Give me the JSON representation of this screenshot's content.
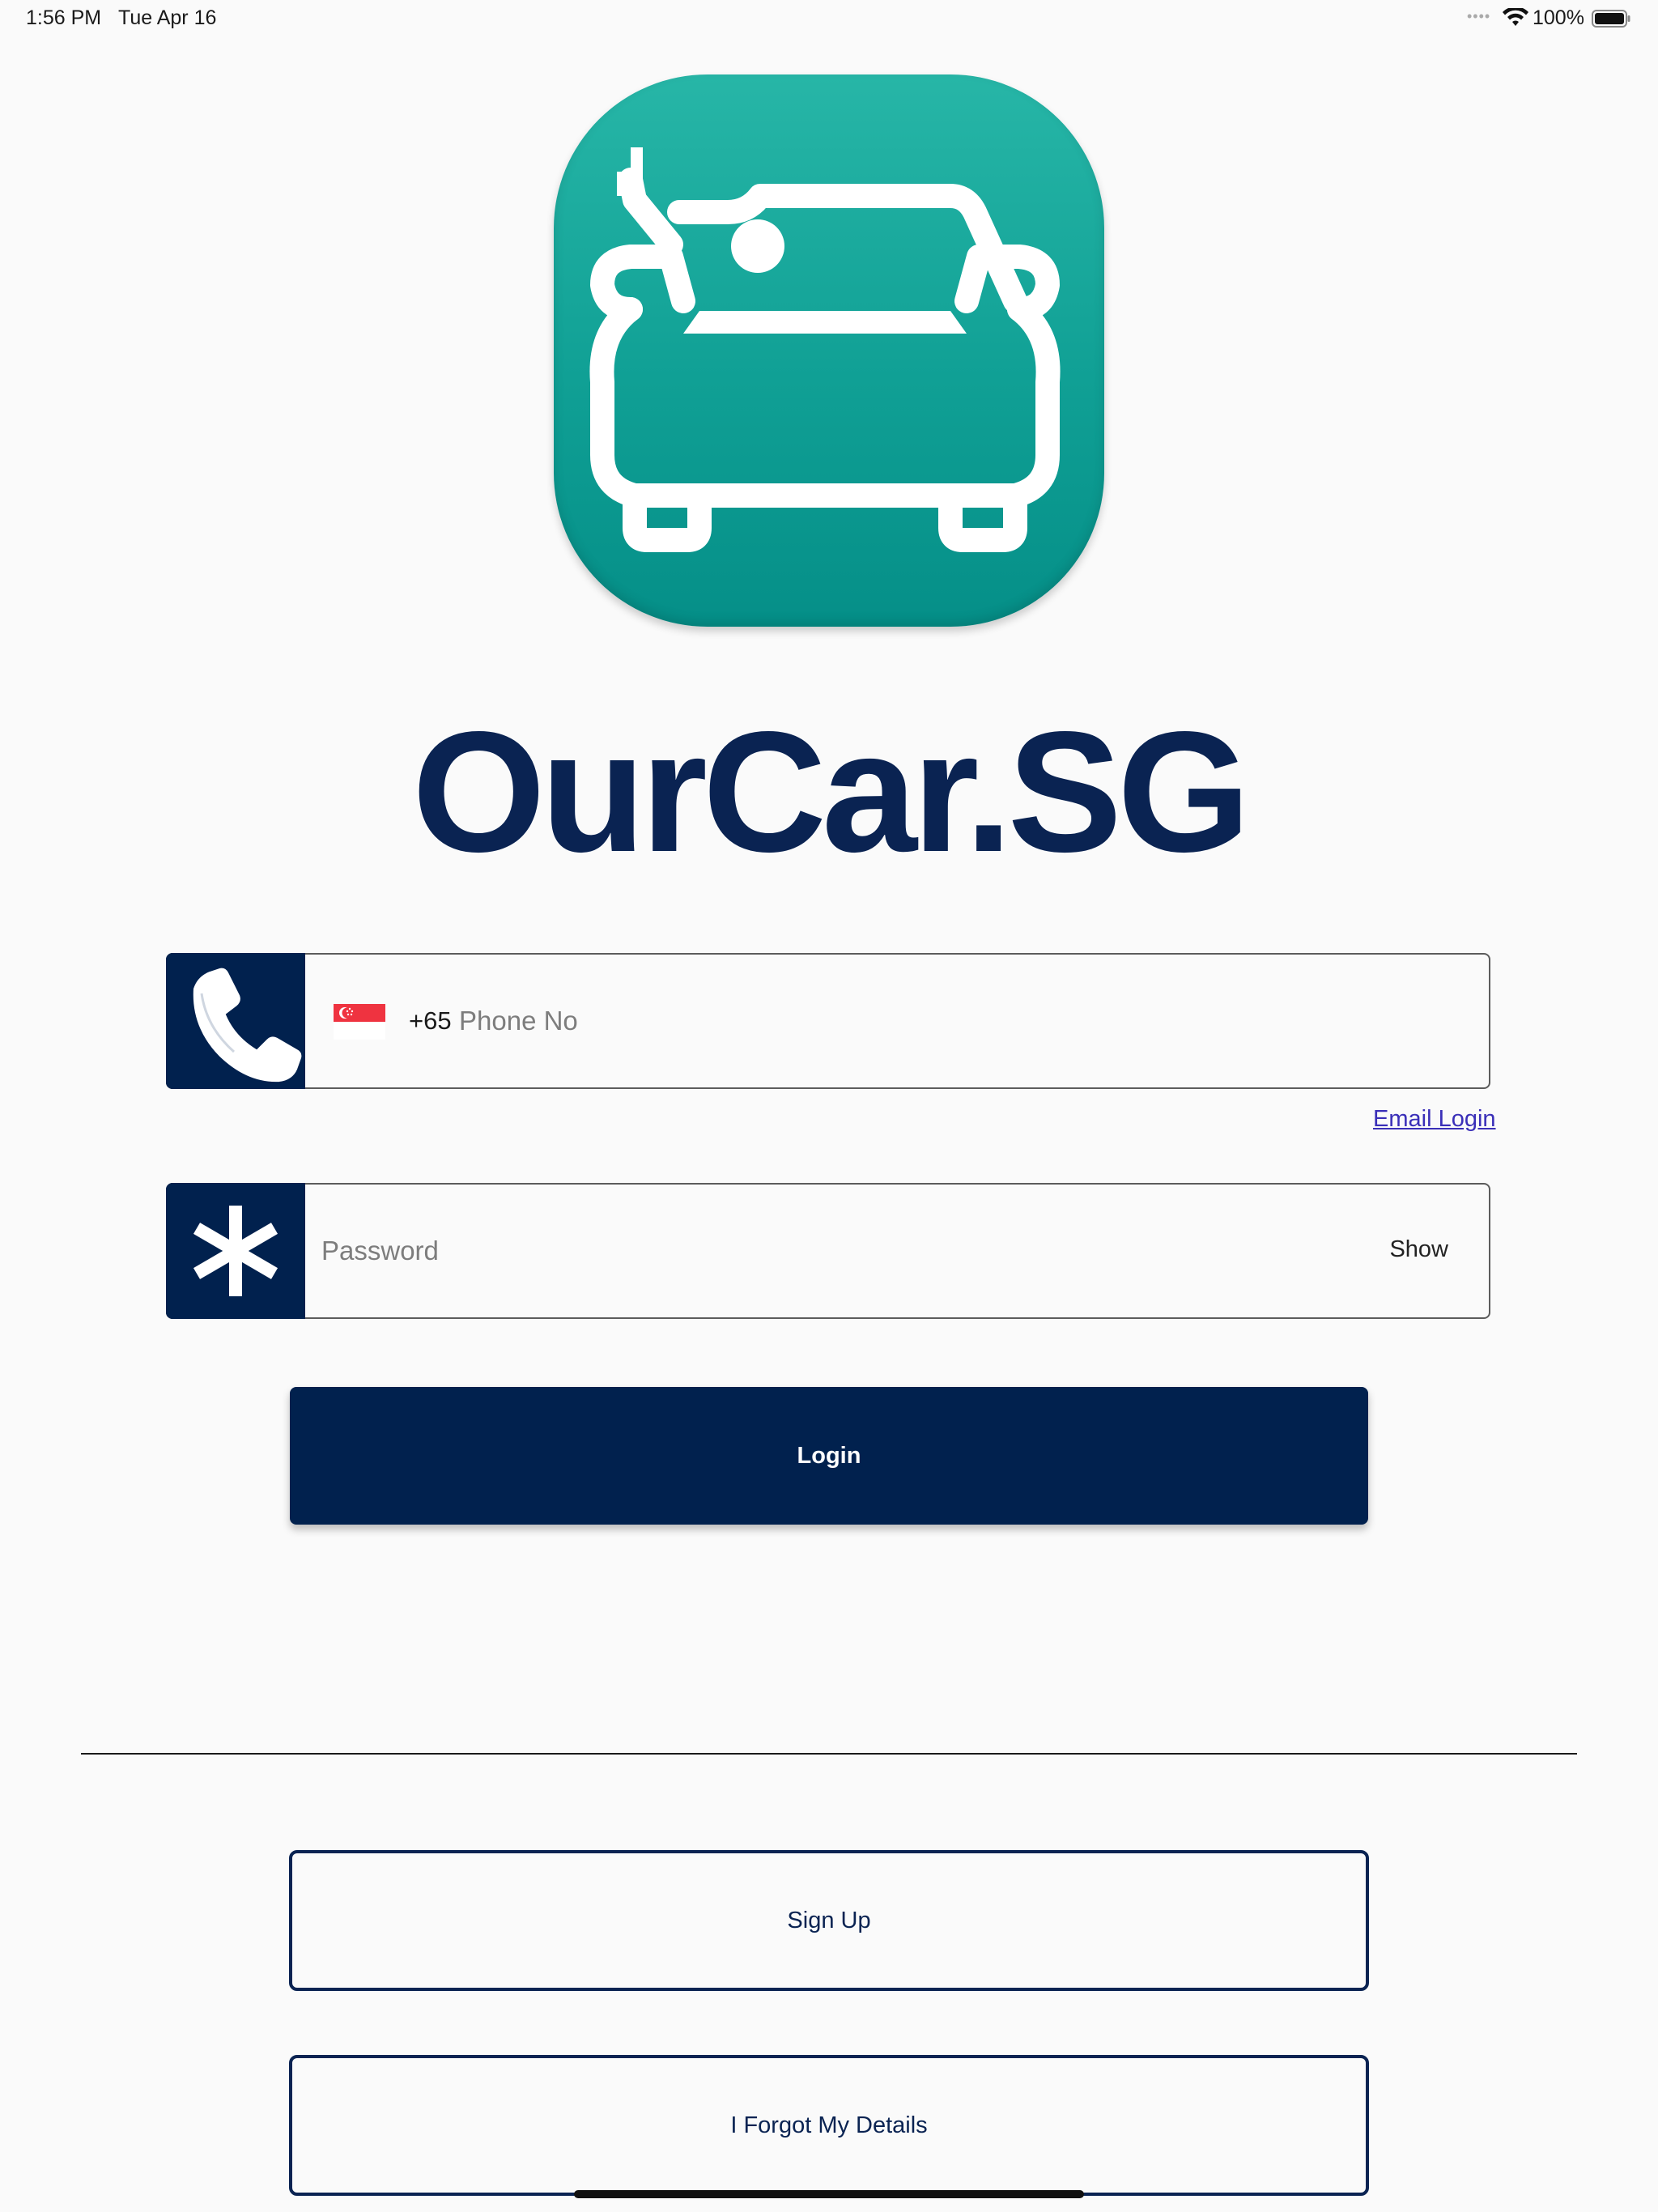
{
  "status_bar": {
    "time": "1:56 PM",
    "date": "Tue Apr 16",
    "battery_percent": "100%",
    "signal_dots": "••••",
    "icons": [
      "wifi-icon",
      "battery-icon"
    ]
  },
  "app_icon": {
    "name": "car-with-driver-waving-logo",
    "colors": {
      "top": "#27b6a7",
      "bottom": "#058f88"
    }
  },
  "brand": {
    "title": "OurCar.SG",
    "color": "#0a2352"
  },
  "phone_field": {
    "icon": "phone-icon",
    "flag": "singapore-flag-icon",
    "country_code": "+65",
    "placeholder": "Phone No",
    "value": ""
  },
  "email_login_link": "Email Login",
  "password_field": {
    "icon": "asterisk-icon",
    "placeholder": "Password",
    "value": "",
    "toggle_label": "Show"
  },
  "login_button": "Login",
  "signup_button": "Sign Up",
  "forgot_button": "I Forgot My Details",
  "colors": {
    "primary": "#01214e",
    "link": "#3a2fb8",
    "background": "#fafafa"
  }
}
